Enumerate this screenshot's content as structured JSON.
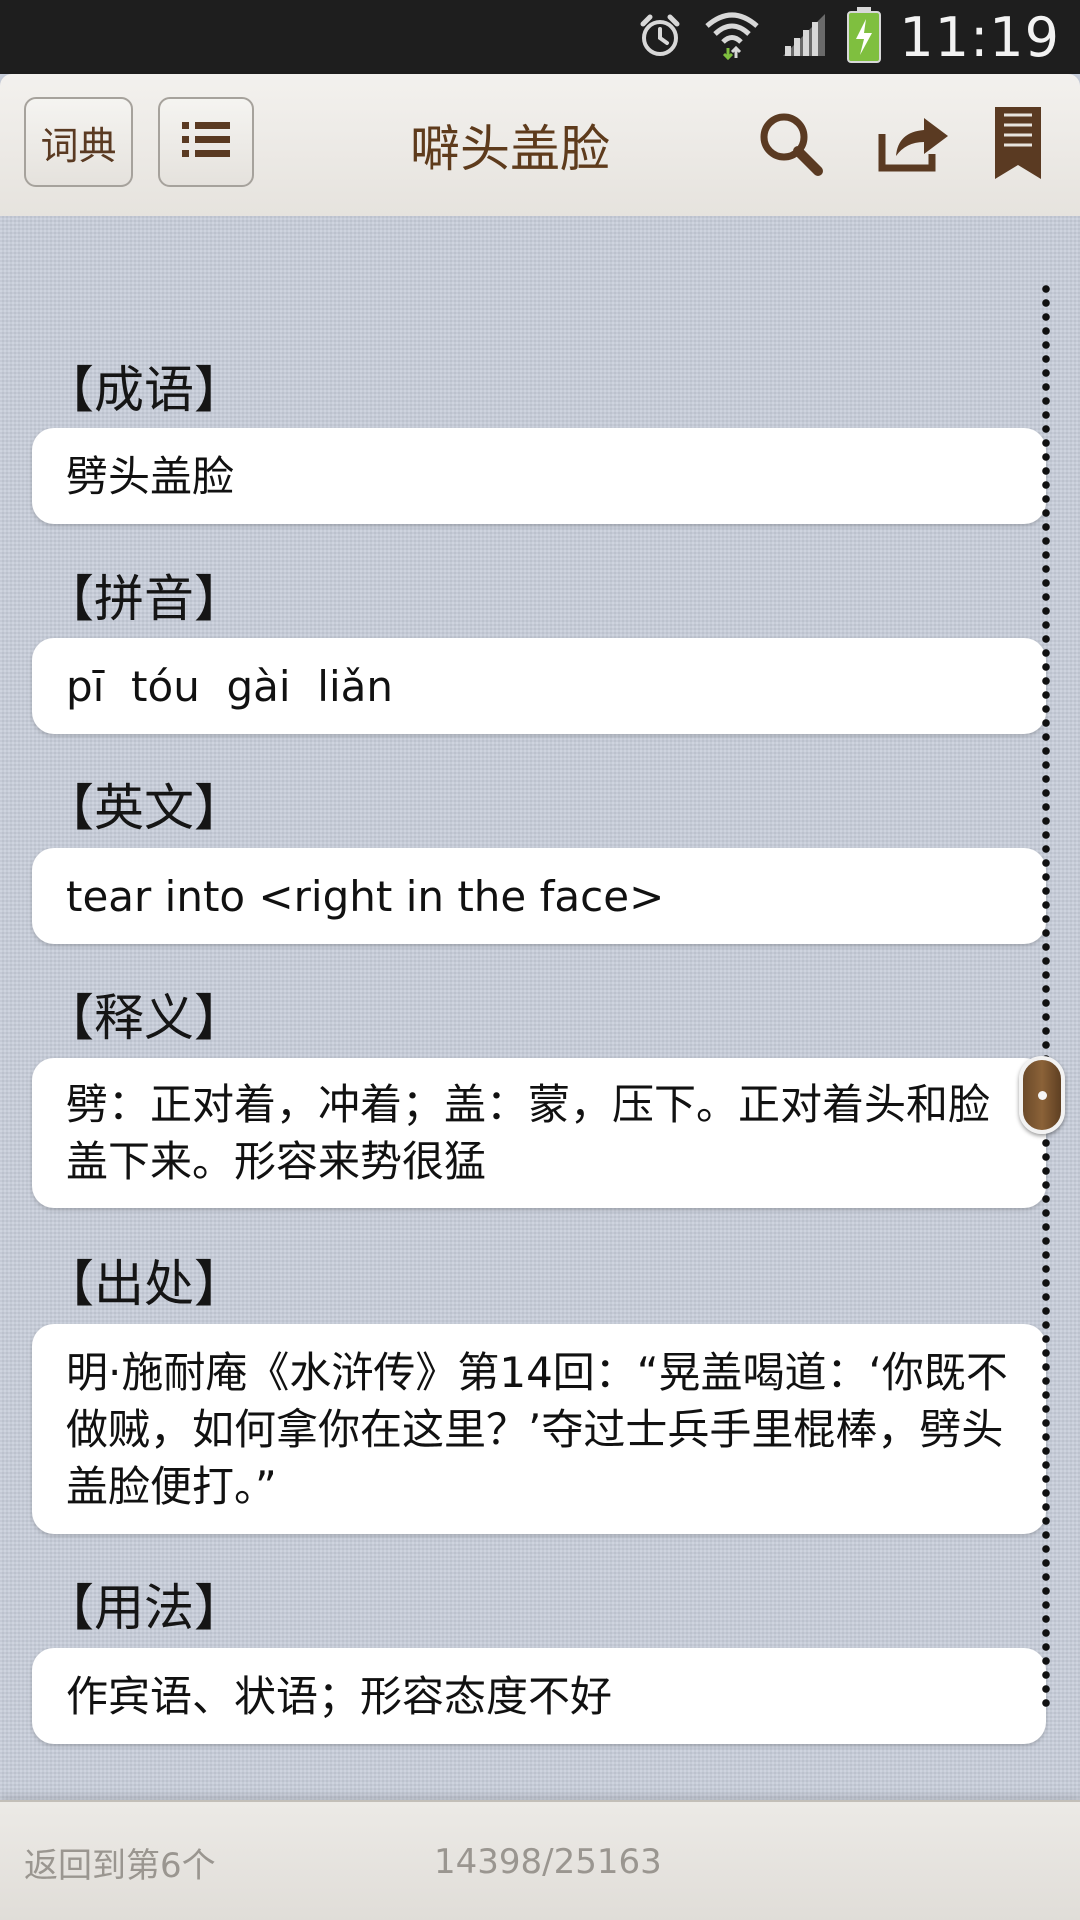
{
  "status_bar": {
    "time": "11:19",
    "icons": [
      "alarm-icon",
      "wifi-icon",
      "signal-icon",
      "battery-charging-icon"
    ]
  },
  "toolbar": {
    "dict_button_label": "词典",
    "list_icon": "list-icon",
    "title": "噼头盖脸",
    "search_icon": "search-icon",
    "share_icon": "share-icon",
    "bookmark_icon": "bookmark-icon"
  },
  "entry": {
    "sections": [
      {
        "header": "【成语】",
        "text": "劈头盖脸"
      },
      {
        "header": "【拼音】",
        "text": "pī  tóu  gài  liǎn"
      },
      {
        "header": "【英文】",
        "text": "tear into <right in the face>"
      },
      {
        "header": "【释义】",
        "text": "劈：正对着，冲着；盖：蒙，压下。正对着头和脸盖下来。形容来势很猛"
      },
      {
        "header": "【出处】",
        "text": "明·施耐庵《水浒传》第14回：“晃盖喝道：‘你既不做贼，如何拿你在这里？’夺过士兵手里棍棒，劈头盖脸便打。”"
      },
      {
        "header": "【用法】",
        "text": "作宾语、状语；形容态度不好"
      }
    ]
  },
  "bottom_bar": {
    "back_label": "返回到第6个",
    "counter": "14398/25163"
  },
  "colors": {
    "accent_brown": "#5e3b1c",
    "background": "#c9cfdb"
  }
}
